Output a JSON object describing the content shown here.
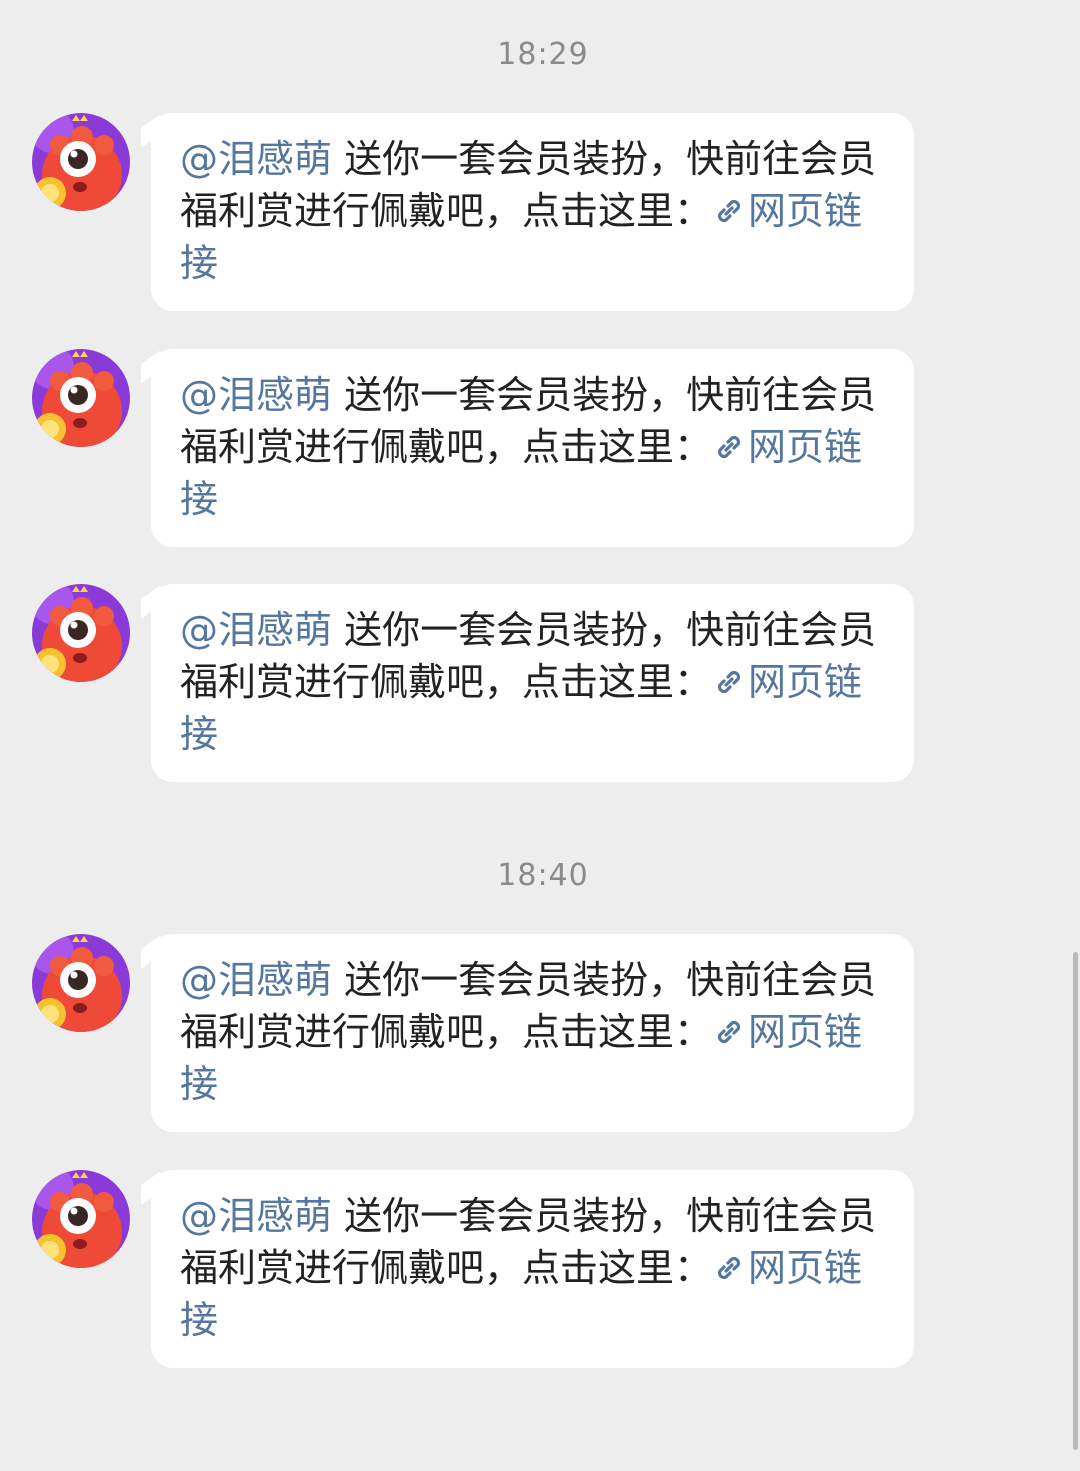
{
  "timestamps": [
    "18:29",
    "18:40"
  ],
  "messages": [
    {
      "mention": "@泪感萌",
      "text": " 送你一套会员装扮，快前往会员福利赏进行佩戴吧，点击这里：",
      "link_icon": "link-icon",
      "link_text": "网页链接",
      "avatar_icon": "cyclops-monster-avatar"
    },
    {
      "mention": "@泪感萌",
      "text": " 送你一套会员装扮，快前往会员福利赏进行佩戴吧，点击这里：",
      "link_icon": "link-icon",
      "link_text": "网页链接",
      "avatar_icon": "cyclops-monster-avatar"
    },
    {
      "mention": "@泪感萌",
      "text": " 送你一套会员装扮，快前往会员福利赏进行佩戴吧，点击这里：",
      "link_icon": "link-icon",
      "link_text": "网页链接",
      "avatar_icon": "cyclops-monster-avatar"
    },
    {
      "mention": "@泪感萌",
      "text": " 送你一套会员装扮，快前往会员福利赏进行佩戴吧，点击这里：",
      "link_icon": "link-icon",
      "link_text": "网页链接",
      "avatar_icon": "cyclops-monster-avatar"
    },
    {
      "mention": "@泪感萌",
      "text": " 送你一套会员装扮，快前往会员福利赏进行佩戴吧，点击这里：",
      "link_icon": "link-icon",
      "link_text": "网页链接",
      "avatar_icon": "cyclops-monster-avatar"
    }
  ],
  "colors": {
    "background": "#ededed",
    "bubble": "#ffffff",
    "text": "#222222",
    "link": "#55779f",
    "timestamp": "#8a8a8a"
  }
}
